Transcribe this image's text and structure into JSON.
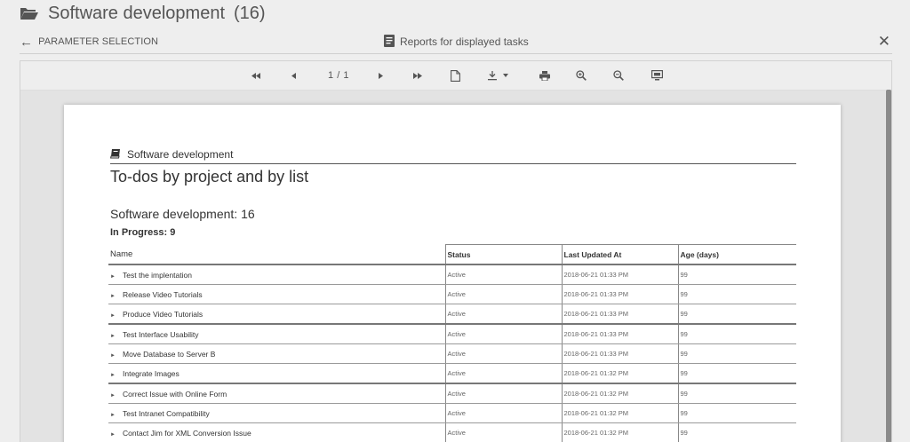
{
  "header": {
    "title": "Software development",
    "count": "(16)"
  },
  "nav": {
    "back_label": "PARAMETER SELECTION",
    "report_title": "Reports for displayed tasks"
  },
  "toolbar": {
    "page_indicator": "1 / 1",
    "icons": [
      "first-page-icon",
      "prev-page-icon",
      "next-page-icon",
      "last-page-icon",
      "document-icon",
      "download-icon",
      "print-icon",
      "zoom-in-icon",
      "zoom-out-icon",
      "fit-icon"
    ]
  },
  "report": {
    "project_label": "Software development",
    "title": "To-dos by project and by list",
    "section": "Software development: 16",
    "group": "In Progress: 9",
    "columns": [
      "Name",
      "Status",
      "Last Updated At",
      "Age (days)"
    ],
    "rows": [
      {
        "name": "Test the implentation",
        "status": "Active",
        "updated": "2018-06-21 01:33 PM",
        "age": "99"
      },
      {
        "name": "Release Video Tutorials",
        "status": "Active",
        "updated": "2018-06-21 01:33 PM",
        "age": "99"
      },
      {
        "name": "Produce Video Tutorials",
        "status": "Active",
        "updated": "2018-06-21 01:33 PM",
        "age": "99"
      },
      {
        "name": "Test Interface Usability",
        "status": "Active",
        "updated": "2018-06-21 01:33 PM",
        "age": "99"
      },
      {
        "name": "Move Database to Server B",
        "status": "Active",
        "updated": "2018-06-21 01:33 PM",
        "age": "99"
      },
      {
        "name": "Integrate Images",
        "status": "Active",
        "updated": "2018-06-21 01:32 PM",
        "age": "99"
      },
      {
        "name": "Correct Issue with Online Form",
        "status": "Active",
        "updated": "2018-06-21 01:32 PM",
        "age": "99"
      },
      {
        "name": "Test Intranet Compatibility",
        "status": "Active",
        "updated": "2018-06-21 01:32 PM",
        "age": "99"
      },
      {
        "name": "Contact Jim for XML Conversion Issue",
        "status": "Active",
        "updated": "2018-06-21 01:32 PM",
        "age": "99"
      }
    ]
  }
}
